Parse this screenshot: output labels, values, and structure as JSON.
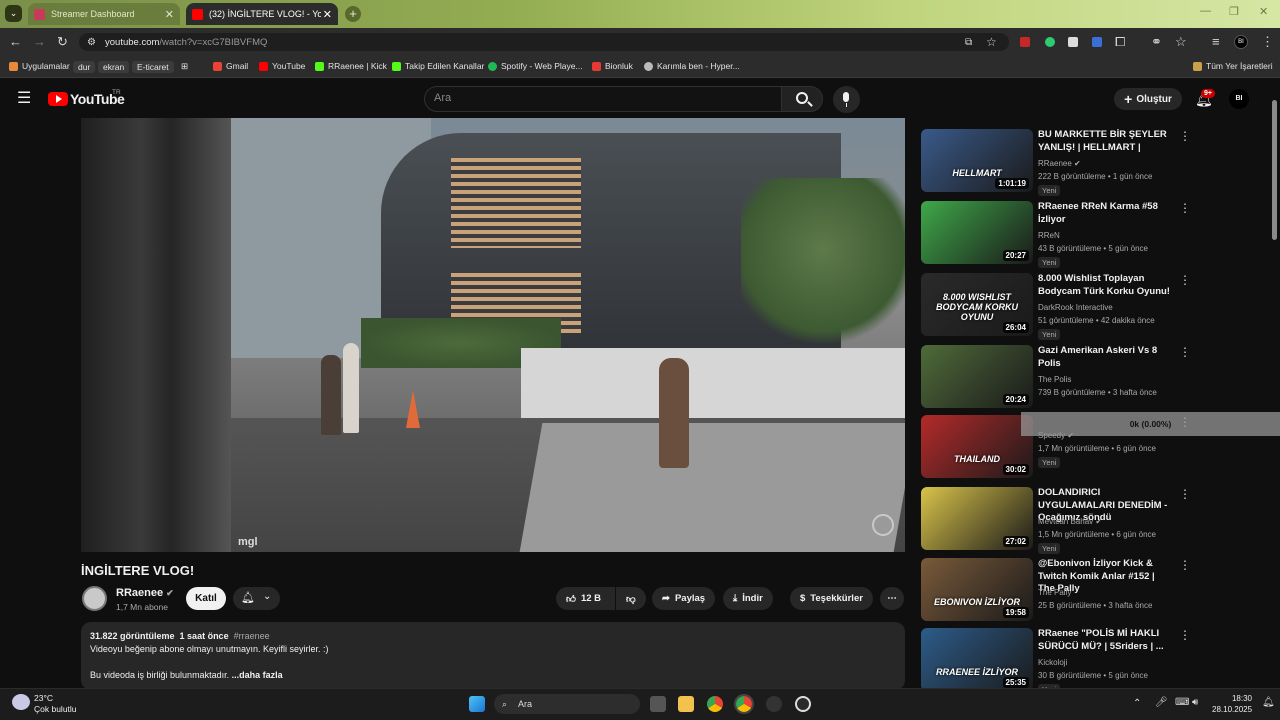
{
  "browser": {
    "tabs": [
      {
        "title": "Streamer Dashboard"
      },
      {
        "title": "(32) İNGİLTERE VLOG! - YouTube"
      }
    ],
    "url_main": "youtube.com",
    "url_path": "/watch?v=xcG7BIBVFMQ",
    "bookmarks": [
      "Uygulamalar",
      "dur",
      "ekran",
      "E-ticaret",
      "Gmail",
      "YouTube",
      "RRaenee | Kick",
      "Takip Edilen Kanallar",
      "Spotify - Web Playe...",
      "Bionluk",
      "Karımla ben - Hyper..."
    ],
    "other_bookmarks": "Tüm Yer İşaretleri"
  },
  "youtube": {
    "logo": "YouTube",
    "logo_region": "TR",
    "search_placeholder": "Ara",
    "create_label": "Oluştur",
    "notif_count": "9+",
    "account_initials": "BI"
  },
  "video": {
    "title": "İNGİLTERE VLOG!",
    "channel": "RRaenee",
    "subscribers": "1,7 Mn abone",
    "join": "Katıl",
    "likes": "12 B",
    "share": "Paylaş",
    "download": "İndir",
    "thanks": "Teşekkürler",
    "views": "31.822 görüntüleme",
    "time_ago": "1 saat önce",
    "hashtag": "#rraenee",
    "desc_line1": "Videoyu beğenip abone olmayı unutmayın. Keyifli seyirler. :)",
    "desc_line2": "Bu videoda iş birliği bulunmaktadır.",
    "more": "...daha fazla",
    "watermark": "mgl"
  },
  "recommendations": [
    {
      "title": "BU MARKETTE BİR ŞEYLER YANLIŞ! | HELLMART |",
      "channel": "RRaenee",
      "verified": true,
      "meta": "222 B görüntüleme • 1 gün önce",
      "badge": "Yeni",
      "duration": "1:01:19",
      "thumb_text": "HELLMART",
      "color": "#3a5a8a"
    },
    {
      "title": "RRaenee RReN Karma #58 İzliyor",
      "channel": "RReN",
      "verified": false,
      "meta": "43 B görüntüleme • 5 gün önce",
      "badge": "Yeni",
      "duration": "20:27",
      "thumb_text": "",
      "color": "#3fa84a"
    },
    {
      "title": "8.000 Wishlist Toplayan Bodycam Türk Korku Oyunu!",
      "channel": "DarkRook Interactive",
      "verified": false,
      "meta": "51 görüntüleme • 42 dakika önce",
      "badge": "Yeni",
      "duration": "26:04",
      "thumb_text": "8.000 WISHLIST BODYCAM KORKU OYUNU",
      "color": "#2a2a2a"
    },
    {
      "title": "Gazi Amerikan Askeri Vs 8 Polis",
      "channel": "The Polis",
      "verified": false,
      "meta": "739 B görüntüleme • 3 hafta önce",
      "badge": "",
      "duration": "20:24",
      "thumb_text": "",
      "color": "#4f6b3a"
    },
    {
      "title": "",
      "channel": "Speedy",
      "verified": true,
      "meta": "1,7 Mn görüntüleme • 6 gün önce",
      "badge": "Yeni",
      "duration": "30:02",
      "thumb_text": "THAILAND",
      "color": "#b52a2a"
    },
    {
      "title": "DOLANDIRICI UYGULAMALARI DENEDİM - Ocağımız söndü",
      "channel": "Mevtcan Bahav",
      "verified": true,
      "meta": "1,5 Mn görüntüleme • 6 gün önce",
      "badge": "Yeni",
      "duration": "27:02",
      "thumb_text": "",
      "color": "#d9c44a"
    },
    {
      "title": "@Ebonivon İzliyor Kick & Twitch Komik Anlar #152 | The Pally",
      "channel": "The Pally",
      "verified": false,
      "meta": "25 B görüntüleme • 3 hafta önce",
      "badge": "",
      "duration": "19:58",
      "thumb_text": "EBONIVON İZLİYOR",
      "color": "#7a5a3a"
    },
    {
      "title": "RRaenee \"POLİS Mİ HAKLI SÜRÜCÜ MÜ? | 5Sriders | ...",
      "channel": "Kickoloji",
      "verified": false,
      "meta": "30 B görüntüleme • 5 gün önce",
      "badge": "Yeni",
      "duration": "25:35",
      "thumb_text": "RRAENEE İZLİYOR",
      "color": "#2d5c8a"
    }
  ],
  "overlay": {
    "line1": "0k (0.00%)"
  },
  "taskbar": {
    "temp": "23°C",
    "weather": "Çok bulutlu",
    "search": "Ara",
    "time": "18:30",
    "date": "28.10.2025"
  }
}
